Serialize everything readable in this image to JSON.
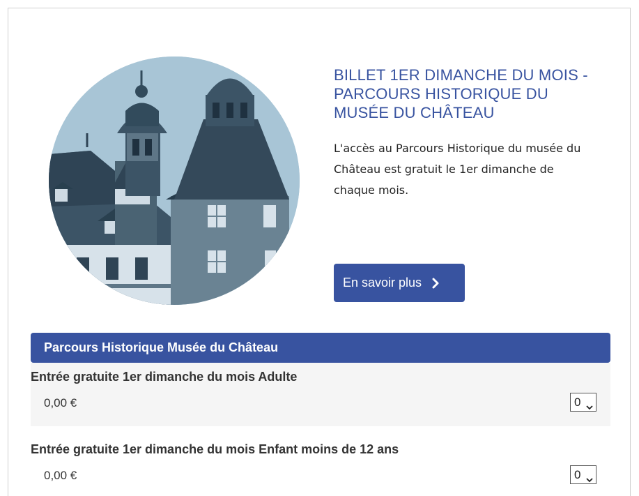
{
  "hero": {
    "image_alt": "Château de Montbéliard towers",
    "title": "BILLET 1ER DIMANCHE DU MOIS - PARCOURS HISTORIQUE DU MUSÉE DU CHÂTEAU",
    "description": "L'accès au Parcours Historique du musée du Château est gratuit le 1er dimanche de chaque mois.",
    "cta_label": "En savoir plus",
    "cta_icon": "chevron-right-icon"
  },
  "section": {
    "title": "Parcours Historique Musée du Château"
  },
  "tickets": [
    {
      "name": "Entrée gratuite 1er dimanche du mois Adulte",
      "price": "0,00 €",
      "quantity": "0"
    },
    {
      "name": "Entrée gratuite 1er dimanche du mois Enfant moins de 12 ans",
      "price": "0,00 €",
      "quantity": "0"
    }
  ],
  "colors": {
    "accent": "#3853a0",
    "row_shade": "#f5f5f5",
    "text": "#333333"
  }
}
